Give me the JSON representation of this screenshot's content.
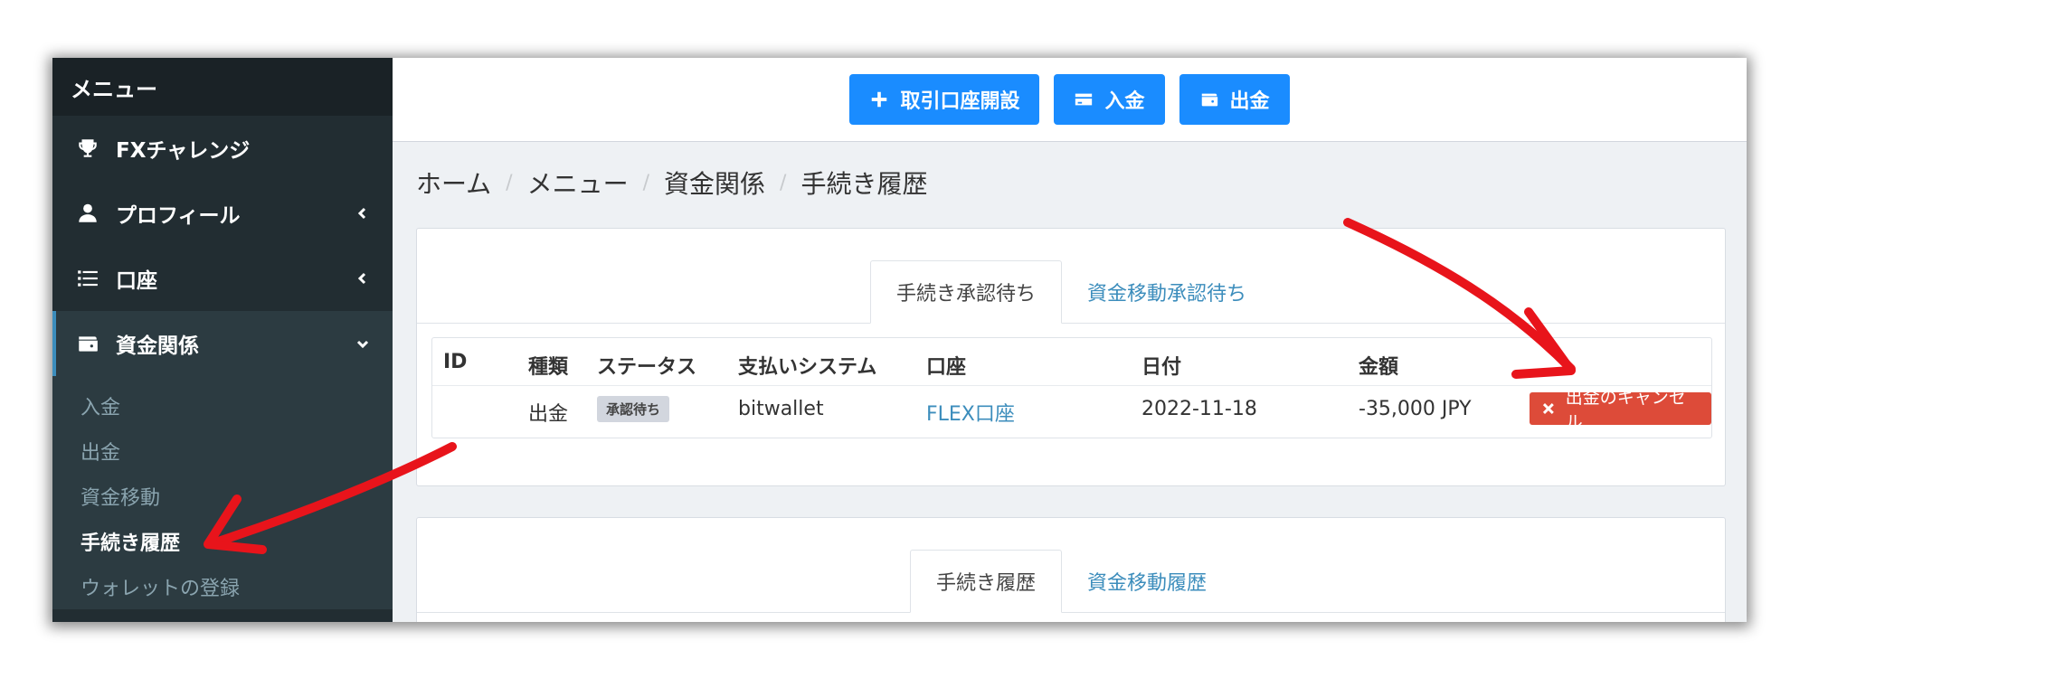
{
  "sidebar": {
    "header": "メニュー",
    "items": [
      {
        "label": "FXチャレンジ",
        "icon": "trophy-icon"
      },
      {
        "label": "プロフィール",
        "icon": "user-icon"
      },
      {
        "label": "口座",
        "icon": "list-icon"
      },
      {
        "label": "資金関係",
        "icon": "wallet-icon"
      }
    ],
    "submenu": [
      "入金",
      "出金",
      "資金移動",
      "手続き履歴",
      "ウォレットの登録"
    ]
  },
  "topbar": {
    "open_account": "取引口座開設",
    "deposit": "入金",
    "withdraw": "出金"
  },
  "breadcrumb": [
    "ホーム",
    "メニュー",
    "資金関係",
    "手続き履歴"
  ],
  "breadcrumb_separator": "/",
  "pending_card": {
    "tabs": [
      "手続き承認待ち",
      "資金移動承認待ち"
    ],
    "columns": [
      "ID",
      "種類",
      "ステータス",
      "支払いシステム",
      "口座",
      "日付",
      "金額"
    ],
    "row": {
      "id": "",
      "type": "出金",
      "status": "承認待ち",
      "payment_system": "bitwallet",
      "account": "FLEX口座",
      "date": "2022-11-18",
      "amount": "-35,000 JPY",
      "action": "出金のキャンセル"
    }
  },
  "history_card": {
    "tabs": [
      "手続き履歴",
      "資金移動履歴"
    ]
  },
  "colors": {
    "sidebar_bg": "#222d32",
    "primary_button": "#1a8cff",
    "danger_button": "#dd4b39",
    "annotation_arrow": "#e8141b"
  }
}
